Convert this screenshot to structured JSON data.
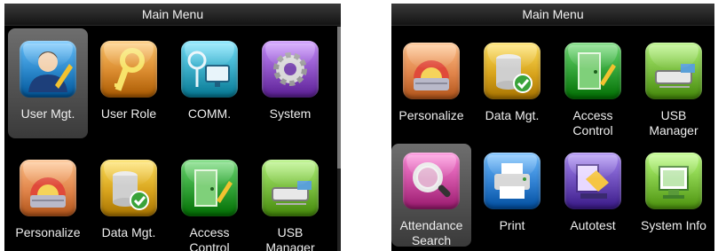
{
  "left_screen": {
    "title": "Main Menu",
    "items": [
      {
        "label": "User Mgt.",
        "icon": "user-icon",
        "color": "#2a86c9",
        "selected": true
      },
      {
        "label": "User Role",
        "icon": "key-icon",
        "color": "#d98a2e",
        "selected": false
      },
      {
        "label": "COMM.",
        "icon": "network-icon",
        "color": "#35a7c2",
        "selected": false
      },
      {
        "label": "System",
        "icon": "gear-icon",
        "color": "#8b4fc4",
        "selected": false
      },
      {
        "label": "Personalize",
        "icon": "color-wheel-icon",
        "color": "#e0844a",
        "selected": false
      },
      {
        "label": "Data Mgt.",
        "icon": "database-icon",
        "color": "#d8a41d",
        "selected": false
      },
      {
        "label": "Access\nControl",
        "icon": "door-icon",
        "color": "#2e9e33",
        "selected": false
      },
      {
        "label": "USB\nManager",
        "icon": "usb-icon",
        "color": "#74b83a",
        "selected": false
      }
    ]
  },
  "right_screen": {
    "title": "Main Menu",
    "items": [
      {
        "label": "Personalize",
        "icon": "color-wheel-icon",
        "color": "#e0844a",
        "selected": false
      },
      {
        "label": "Data Mgt.",
        "icon": "database-icon",
        "color": "#d8a41d",
        "selected": false
      },
      {
        "label": "Access\nControl",
        "icon": "door-icon",
        "color": "#2e9e33",
        "selected": false
      },
      {
        "label": "USB\nManager",
        "icon": "usb-icon",
        "color": "#74b83a",
        "selected": false
      },
      {
        "label": "Attendance\nSearch",
        "icon": "magnifier-icon",
        "color": "#c94a9e",
        "selected": true
      },
      {
        "label": "Print",
        "icon": "printer-icon",
        "color": "#2f7fd0",
        "selected": false
      },
      {
        "label": "Autotest",
        "icon": "autotest-icon",
        "color": "#6a4ab8",
        "selected": false
      },
      {
        "label": "System Info",
        "icon": "info-icon",
        "color": "#7cc23e",
        "selected": false
      }
    ]
  }
}
